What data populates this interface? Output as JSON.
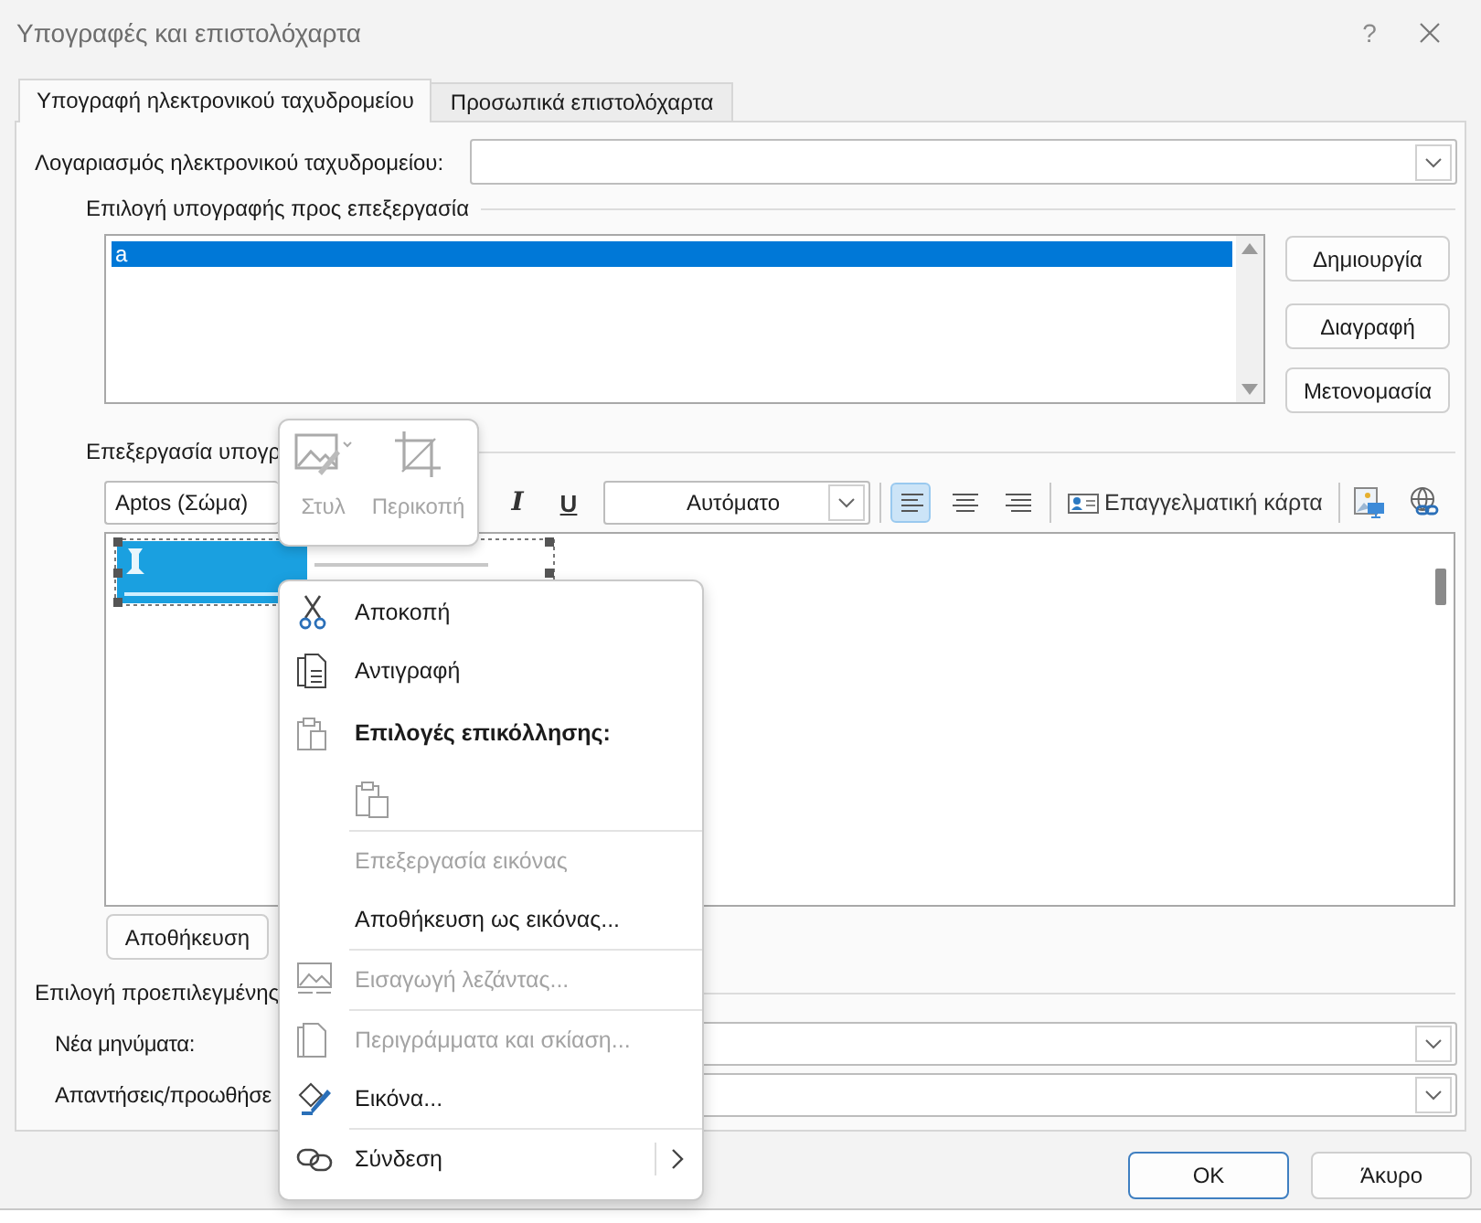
{
  "window": {
    "title": "Υπογραφές και επιστολόχαρτα",
    "help": "?"
  },
  "tabs": [
    {
      "label": "Υπογραφή ηλεκτρονικού ταχυδρομείου",
      "selected": true
    },
    {
      "label": "Προσωπικά επιστολόχαρτα",
      "selected": false
    }
  ],
  "account": {
    "label": "Λογαριασμός ηλεκτρονικού ταχυδρομείου:"
  },
  "select_signature": {
    "heading": "Επιλογή υπογραφής προς επεξεργασία",
    "items": [
      {
        "label": "a",
        "selected": true
      }
    ],
    "buttons": [
      "Δημιουργία",
      "Διαγραφή",
      "Μετονομασία"
    ]
  },
  "edit_signature": {
    "heading": "Επεξεργασία υπογρ",
    "font": "Aptos (Σώμα)",
    "italic": "I",
    "underline": "U",
    "colour_dropdown": "Αυτόματο",
    "alignment": [
      {
        "kind": "left",
        "selected": true
      },
      {
        "kind": "center",
        "selected": false
      },
      {
        "kind": "right",
        "selected": false
      }
    ],
    "business_card": "Επαγγελματική κάρτα",
    "save": "Αποθήκευση"
  },
  "defaults": {
    "heading": "Επιλογή προεπιλεγμένης",
    "rows": [
      {
        "label": "Νέα μηνύματα:"
      },
      {
        "label": "Απαντήσεις/προωθήσε"
      }
    ]
  },
  "footer": [
    {
      "label": "OK",
      "default": true
    },
    {
      "label": "Άκυρο",
      "default": false
    }
  ],
  "mini_toolbar": [
    {
      "label": "Στυλ",
      "disabled": true
    },
    {
      "label": "Περικοπή",
      "disabled": true
    }
  ],
  "context_menu": [
    {
      "kind": "item",
      "label": "Αποκοπή",
      "disabled": false,
      "submenu": false
    },
    {
      "kind": "item",
      "label": "Αντιγραφή",
      "disabled": false,
      "submenu": false
    },
    {
      "kind": "header",
      "label": "Επιλογές επικόλλησης:"
    },
    {
      "kind": "paste"
    },
    {
      "kind": "separator"
    },
    {
      "kind": "item",
      "label": "Επεξεργασία εικόνας",
      "disabled": true,
      "submenu": false
    },
    {
      "kind": "item",
      "label": "Αποθήκευση ως εικόνας...",
      "disabled": false,
      "submenu": false
    },
    {
      "kind": "separator"
    },
    {
      "kind": "item",
      "label": "Εισαγωγή λεζάντας...",
      "disabled": true,
      "submenu": false
    },
    {
      "kind": "separator"
    },
    {
      "kind": "item",
      "label": "Περιγράμματα και σκίαση...",
      "disabled": true,
      "submenu": false
    },
    {
      "kind": "item",
      "label": "Εικόνα...",
      "disabled": false,
      "submenu": false
    },
    {
      "kind": "separator"
    },
    {
      "kind": "item",
      "label": "Σύνδεση",
      "disabled": false,
      "submenu": true
    }
  ]
}
